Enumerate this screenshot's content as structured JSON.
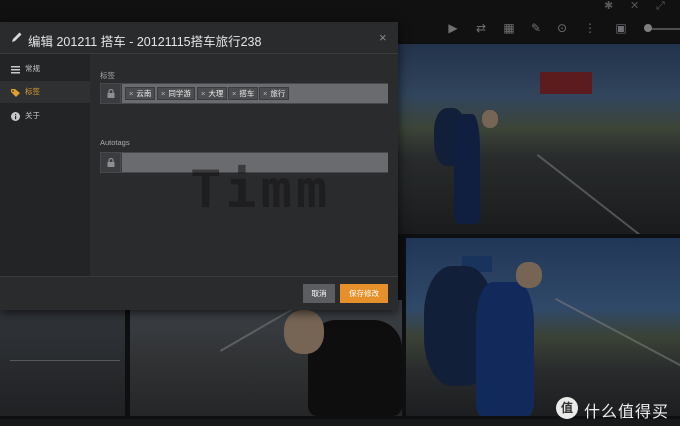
{
  "modal": {
    "title": "编辑 201211 搭车 - 20121115搭车旅行238",
    "close": "×",
    "sidebar": {
      "items": [
        {
          "label": "常规",
          "icon": "general-icon",
          "active": false
        },
        {
          "label": "标签",
          "icon": "tag-icon",
          "active": true
        },
        {
          "label": "关于",
          "icon": "info-icon",
          "active": false
        }
      ]
    },
    "fields": {
      "tags_label": "标签",
      "tags": [
        "云南",
        "同学游",
        "大理",
        "搭车",
        "旅行"
      ],
      "tag_remove": "×",
      "autotags_label": "Autotags",
      "autotags_value": ""
    },
    "footer": {
      "cancel_label": "取消",
      "save_label": "保存修改"
    }
  },
  "watermark_text": "Timm",
  "site_watermark": {
    "logo_glyph": "值",
    "text": "什么值得买"
  },
  "toolbar": {
    "icons": [
      "play-icon",
      "shuffle-icon",
      "map-icon",
      "edit-icon",
      "download-icon",
      "more-icon",
      "image-icon",
      "zoom-slider"
    ]
  },
  "colors": {
    "accent": "#e5902a",
    "active_tab_text": "#e0a030",
    "modal_bg": "#2a2b2d"
  }
}
